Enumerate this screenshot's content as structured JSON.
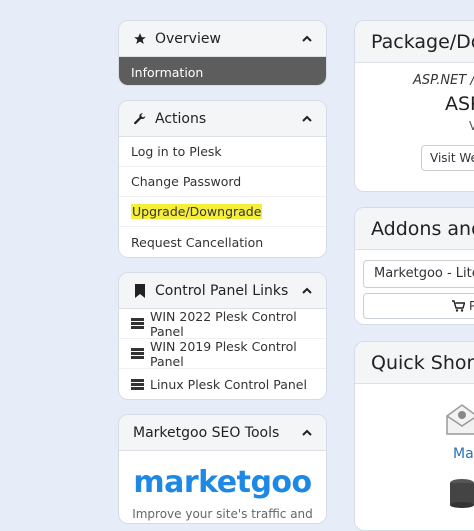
{
  "left": {
    "overview": {
      "title": "Overview",
      "items": [
        "Information"
      ]
    },
    "actions": {
      "title": "Actions",
      "items": [
        "Log in to Plesk",
        "Change Password",
        "Upgrade/Downgrade",
        "Request Cancellation"
      ]
    },
    "control_panel_links": {
      "title": "Control Panel Links",
      "items": [
        "WIN 2022 Plesk Control Panel",
        "WIN 2019 Plesk Control Panel",
        "Linux Plesk Control Panel"
      ]
    },
    "marketgoo": {
      "title": "Marketgoo SEO Tools",
      "logo_text": "marketgoo",
      "tagline": "Improve your site's traffic and"
    }
  },
  "right": {
    "package": {
      "title": "Package/Do",
      "line1": "ASP.NET /",
      "line2": "ASP",
      "line3": "V",
      "button": "Visit Web"
    },
    "addons": {
      "title": "Addons and",
      "select_value": "Marketgoo - Lite",
      "button": "P"
    },
    "quick": {
      "title": "Quick Shorte",
      "label": "Ma"
    }
  },
  "colors": {
    "background": "#e6ecf8",
    "active": "#5d5d5d",
    "highlight": "#f6ef3a",
    "logo": "#1e88e5"
  }
}
